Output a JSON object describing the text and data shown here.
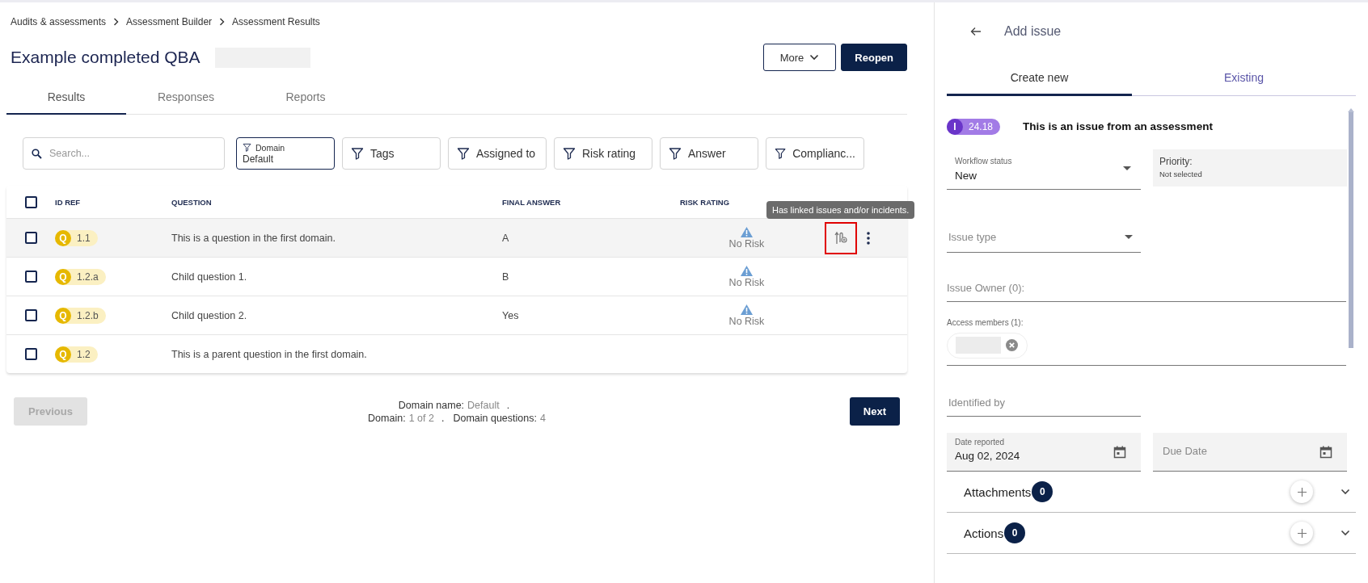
{
  "breadcrumbs": [
    "Audits & assessments",
    "Assessment Builder",
    "Assessment Results"
  ],
  "title": "Example completed QBA",
  "actions": [
    {
      "label": "More",
      "kind": "menu"
    },
    {
      "label": "Reopen",
      "kind": "primary"
    }
  ],
  "tabs": [
    {
      "label": "Results",
      "selected": true
    },
    {
      "label": "Responses",
      "selected": false
    },
    {
      "label": "Reports",
      "selected": false
    }
  ],
  "search": {
    "placeholder": "Search..."
  },
  "filters": [
    {
      "label": "Domain",
      "value": "Default"
    },
    {
      "label": "Tags"
    },
    {
      "label": "Assigned to"
    },
    {
      "label": "Risk rating"
    },
    {
      "label": "Answer"
    },
    {
      "label": "Complianc..."
    }
  ],
  "table": {
    "select_all": {
      "checked": false
    },
    "columns": [
      "ID REF",
      "QUESTION",
      "FINAL ANSWER",
      "RISK RATING"
    ],
    "rows": [
      {
        "checked": false,
        "highlighted": true,
        "type": "Q",
        "ref": "1.1",
        "question": "This is a question in the first domain.",
        "answer": "A",
        "risk": "No Risk",
        "linked": true
      },
      {
        "checked": false,
        "highlighted": false,
        "type": "Q",
        "ref": "1.2.a",
        "question": "Child question 1.",
        "answer": "B",
        "risk": "No Risk",
        "linked": false
      },
      {
        "checked": false,
        "highlighted": false,
        "type": "Q",
        "ref": "1.2.b",
        "question": "Child question 2.",
        "answer": "Yes",
        "risk": "No Risk",
        "linked": false
      },
      {
        "checked": false,
        "highlighted": false,
        "type": "Q",
        "ref": "1.2",
        "question": "This is a parent question in the first domain.",
        "linked": false
      }
    ]
  },
  "tooltip": "Has linked issues and/or incidents.",
  "pager": {
    "previous": {
      "label": "Previous",
      "disabled": true
    },
    "next": {
      "label": "Next",
      "disabled": false
    },
    "lines": [
      [
        {
          "kind": "pair",
          "label": "Domain name:",
          "value": "Default"
        },
        {
          "kind": "sep",
          "text": "."
        }
      ],
      [
        {
          "kind": "pair",
          "label": "Domain:",
          "value": "1 of 2"
        },
        {
          "kind": "sep",
          "text": "."
        },
        {
          "kind": "pair",
          "label": "Domain questions:",
          "value": "4"
        }
      ]
    ]
  },
  "issue_panel": {
    "title": "Add issue",
    "tabs": [
      {
        "label": "Create new",
        "selected": true
      },
      {
        "label": "Existing",
        "selected": false
      }
    ],
    "issue": {
      "type": "I",
      "ref": "24.18",
      "title": "This is an issue from an assessment"
    },
    "workflow_status": {
      "label": "Workflow status",
      "value": "New"
    },
    "priority": {
      "label": "Priority:",
      "value": "Not selected"
    },
    "issue_type": {
      "placeholder": "Issue type"
    },
    "issue_owner": {
      "label": "Issue Owner (0):"
    },
    "access_members": {
      "label": "Access members (1):"
    },
    "identified_by": {
      "placeholder": "Identified by"
    },
    "date_reported": {
      "label": "Date reported",
      "value": "Aug 02, 2024"
    },
    "due_date": {
      "placeholder": "Due Date"
    },
    "sections": [
      {
        "title": "Attachments",
        "count": "0"
      },
      {
        "title": "Actions",
        "count": "0"
      }
    ]
  }
}
